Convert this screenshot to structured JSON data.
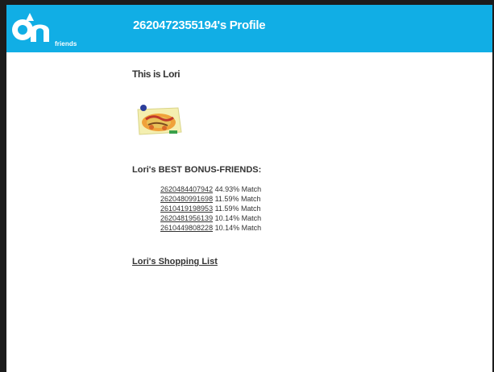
{
  "header": {
    "logo_subtext": "friends",
    "title": "2620472355194's Profile"
  },
  "profile": {
    "intro": "This is Lori"
  },
  "friends_section": {
    "title": "Lori's BEST BONUS-FRIENDS:",
    "items": [
      {
        "id": "2620484407942",
        "match": "44.93% Match"
      },
      {
        "id": "2620480991698",
        "match": "11.59% Match"
      },
      {
        "id": "2610419198953",
        "match": "11.59% Match"
      },
      {
        "id": "2620481956139",
        "match": "10.14% Match"
      },
      {
        "id": "2610449808228",
        "match": "10.14% Match"
      }
    ]
  },
  "shopping_list": {
    "label": "Lori's Shopping List"
  },
  "colors": {
    "header_bg": "#11aee5",
    "text": "#333333",
    "frame": "#1c1c1c"
  },
  "icons": {
    "logo": "ah-logo-icon",
    "product": "product-package-image"
  }
}
